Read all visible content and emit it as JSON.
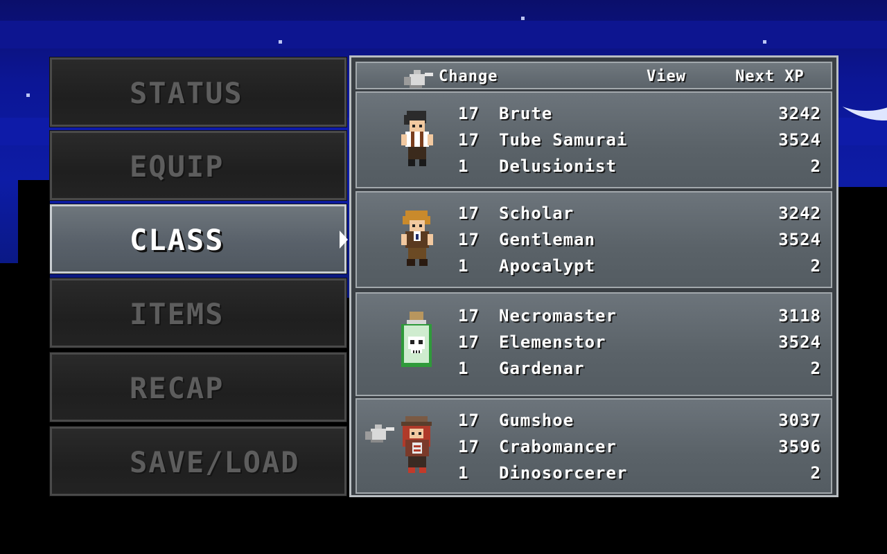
{
  "menu": {
    "items": [
      {
        "label": "STATUS",
        "selected": false
      },
      {
        "label": "EQUIP",
        "selected": false
      },
      {
        "label": "CLASS",
        "selected": true
      },
      {
        "label": "ITEMS",
        "selected": false
      },
      {
        "label": "RECAP",
        "selected": false
      },
      {
        "label": "SAVE/LOAD",
        "selected": false
      }
    ]
  },
  "header": {
    "change_label": "Change",
    "view_label": "View",
    "next_xp_label": "Next XP"
  },
  "characters": [
    {
      "portrait_icon": "dark-haired-fighter-sprite",
      "classes": [
        {
          "level": "17",
          "name": "Brute",
          "next_xp": "3242"
        },
        {
          "level": "17",
          "name": "Tube Samurai",
          "next_xp": "3524"
        },
        {
          "level": "1",
          "name": "Delusionist",
          "next_xp": "2"
        }
      ]
    },
    {
      "portrait_icon": "blond-gentleman-sprite",
      "classes": [
        {
          "level": "17",
          "name": "Scholar",
          "next_xp": "3242"
        },
        {
          "level": "17",
          "name": "Gentleman",
          "next_xp": "3524"
        },
        {
          "level": "1",
          "name": "Apocalypt",
          "next_xp": "2"
        }
      ]
    },
    {
      "portrait_icon": "skull-jar-sprite",
      "classes": [
        {
          "level": "17",
          "name": "Necromaster",
          "next_xp": "3118"
        },
        {
          "level": "17",
          "name": "Elemenstor",
          "next_xp": "3524"
        },
        {
          "level": "1",
          "name": "Gardenar",
          "next_xp": "2"
        }
      ]
    },
    {
      "portrait_icon": "red-haired-detective-sprite",
      "selected": true,
      "classes": [
        {
          "level": "17",
          "name": "Gumshoe",
          "next_xp": "3037"
        },
        {
          "level": "17",
          "name": "Crabomancer",
          "next_xp": "3596"
        },
        {
          "level": "1",
          "name": "Dinosorcerer",
          "next_xp": "2"
        }
      ]
    }
  ],
  "colors": {
    "sky": "#0c1696",
    "panel_fill": "#5a6268",
    "panel_border": "#b9bec2",
    "menu_inactive_text": "#5d5d5d",
    "menu_active_text": "#ffffff"
  }
}
